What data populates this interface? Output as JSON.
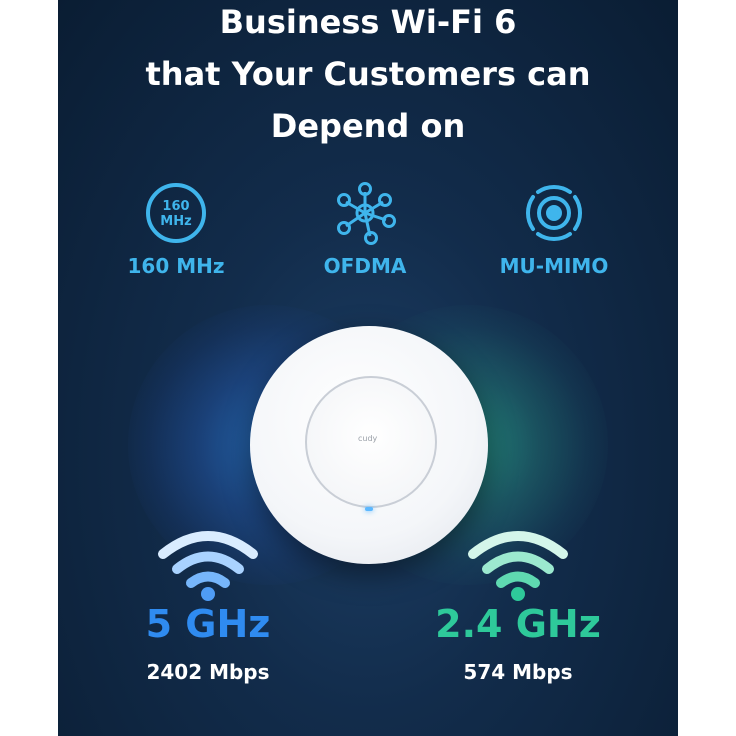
{
  "headline": {
    "line1": "Business Wi-Fi 6",
    "line2": "that Your Customers can",
    "line3": "Depend on"
  },
  "features": [
    {
      "icon": "160mhz-icon",
      "icon_text_top": "160",
      "icon_text_bottom": "MHz",
      "label": "160 MHz"
    },
    {
      "icon": "ofdma-network-icon",
      "label": "OFDMA"
    },
    {
      "icon": "mu-mimo-signal-icon",
      "label": "MU-MIMO"
    }
  ],
  "device": {
    "brand": "cudy"
  },
  "bands": [
    {
      "icon": "wifi-icon",
      "freq": "5 GHz",
      "speed": "2402 Mbps",
      "color": "#2f8bf0"
    },
    {
      "icon": "wifi-icon",
      "freq": "2.4 GHz",
      "speed": "574 Mbps",
      "color": "#2ec99a"
    }
  ],
  "colors": {
    "background": "#0d2440",
    "accent_blue": "#3fb5ec",
    "band_5ghz": "#2f8bf0",
    "band_24ghz": "#2ec99a"
  }
}
